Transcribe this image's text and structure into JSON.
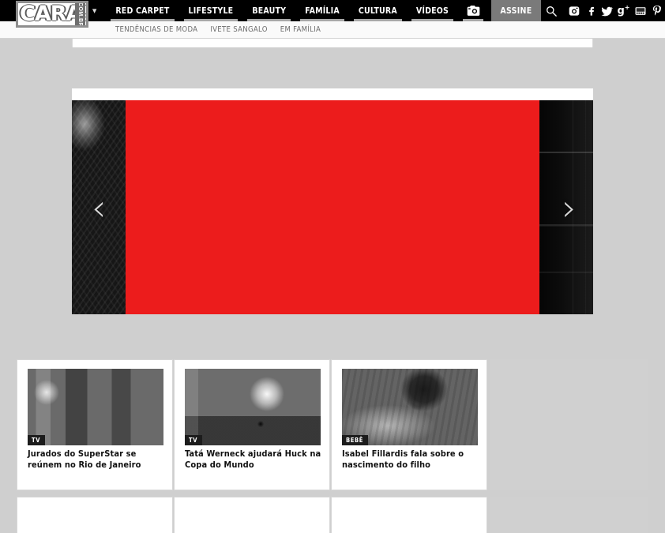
{
  "site": {
    "logo_main": "CARAS",
    "logo_sub": "COM.BR"
  },
  "header": {
    "caret_icon": "chevron-down-icon",
    "nav": [
      {
        "label": "RED CARPET"
      },
      {
        "label": "LIFESTYLE"
      },
      {
        "label": "BEAUTY"
      },
      {
        "label": "FAMÍLIA"
      },
      {
        "label": "CULTURA"
      },
      {
        "label": "VÍDEOS"
      }
    ],
    "camera_icon": "camera-icon",
    "subscribe_label": "ASSINE",
    "search_icon": "search-icon",
    "social": [
      {
        "name": "instagram-icon",
        "glyph": "◱"
      },
      {
        "name": "facebook-icon",
        "glyph": "f"
      },
      {
        "name": "twitter-icon",
        "glyph": "ᵗ"
      },
      {
        "name": "google-plus-icon",
        "glyph": "g⁺"
      },
      {
        "name": "youtube-icon",
        "glyph": "▶"
      },
      {
        "name": "pinterest-icon",
        "glyph": "℗"
      }
    ]
  },
  "subnav": [
    {
      "label": "TENDÊNCIAS DE MODA"
    },
    {
      "label": "IVETE SANGALO"
    },
    {
      "label": "EM FAMÍLIA"
    }
  ],
  "hero": {
    "prev_arrow": "‹",
    "next_arrow": "›",
    "slide_color": "#ec1c1c"
  },
  "cards": [
    {
      "badge": "TV",
      "title": "Jurados do SuperStar se reúnem no Rio de Janeiro",
      "thumb": "thumb-group-photo"
    },
    {
      "badge": "TV",
      "title": "Tatá Werneck ajudará Huck na Copa do Mundo",
      "thumb": "thumb-woman-microphone"
    },
    {
      "badge": "BEBÊ",
      "title": "Isabel Fillardis fala sobre o nascimento do filho",
      "thumb": "thumb-mother-baby"
    }
  ],
  "colors": {
    "header_bg": "#000000",
    "accent_red": "#ec1c1c",
    "page_bg": "#cfcfcf",
    "subscribe_bg": "#7a7a7a",
    "ad_placeholder": "#d0d0d0"
  }
}
